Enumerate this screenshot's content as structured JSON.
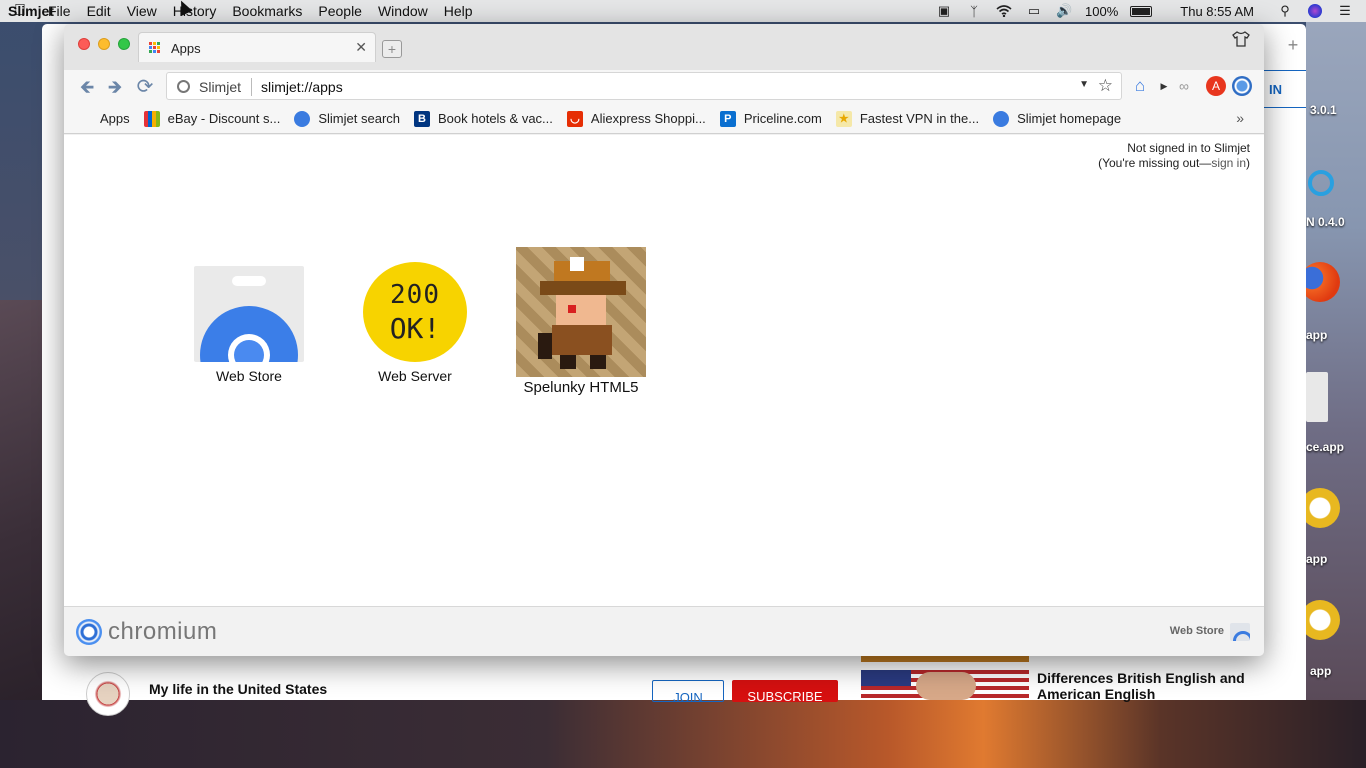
{
  "menubar": {
    "app_name": "Slimjet",
    "items": [
      "File",
      "Edit",
      "View",
      "History",
      "Bookmarks",
      "People",
      "Window",
      "Help"
    ],
    "battery": "100%",
    "clock": "Thu 8:55 AM"
  },
  "background_window": {
    "video_title": "My life in the United States",
    "join_label": "JOIN",
    "subscribe_label": "SUBSCRIBE",
    "related_title": "Differences British English and American English",
    "signin_partial": "IN",
    "subscribe_color": "#d61010",
    "join_color": "#1565c0"
  },
  "desktop_labels": [
    "3.0.1",
    "N 0.4.0",
    "app",
    "ce.app",
    "app",
    "app"
  ],
  "browser": {
    "tab": {
      "title": "Apps"
    },
    "omnibox": {
      "scheme_label": "Slimjet",
      "url": "slimjet://apps"
    },
    "bookmarks": [
      {
        "label": "Apps",
        "icon": "apps-grid-icon",
        "color": "#4285f4"
      },
      {
        "label": "eBay - Discount s...",
        "icon": "ebay-bag-icon",
        "color": "#86b817"
      },
      {
        "label": "Slimjet search",
        "icon": "globe-icon",
        "color": "#3a7be0"
      },
      {
        "label": "Book hotels & vac...",
        "icon": "booking-icon",
        "color": "#003580"
      },
      {
        "label": "Aliexpress Shoppi...",
        "icon": "aliexpress-icon",
        "color": "#e62e04"
      },
      {
        "label": "Priceline.com",
        "icon": "priceline-icon",
        "color": "#0a6fd0"
      },
      {
        "label": "Fastest VPN in the...",
        "icon": "vpn-star-icon",
        "color": "#f5c518"
      },
      {
        "label": "Slimjet homepage",
        "icon": "globe-icon",
        "color": "#3a7be0"
      }
    ],
    "signin_status": {
      "line1": "Not signed in to Slimjet",
      "line2_prefix": "(You're missing out—",
      "link": "sign in",
      "line2_suffix": ")"
    },
    "apps": [
      {
        "label": "Web Store",
        "icon": "web-store-icon"
      },
      {
        "label": "Web Server",
        "icon": "web-server-icon",
        "icon_text_1": "200",
        "icon_text_2": "OK!"
      },
      {
        "label": "Spelunky HTML5",
        "icon": "spelunky-icon"
      }
    ],
    "footer": {
      "brand": "chromium",
      "web_store_link": "Web Store"
    }
  }
}
